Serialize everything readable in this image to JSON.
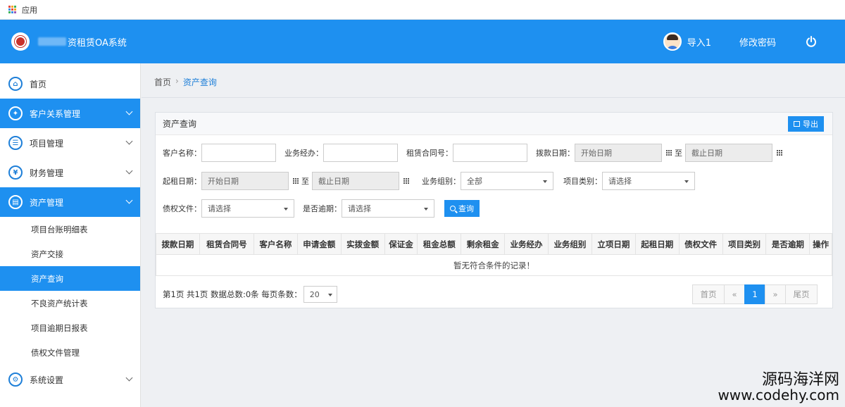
{
  "appbar": {
    "label": "应用",
    "dots": [
      "#e8483b",
      "#f5a623",
      "#3db35a",
      "#3a8ee6",
      "#e8483b",
      "#f5a623",
      "#3db35a",
      "#3a8ee6",
      "#9b59b6"
    ]
  },
  "header": {
    "system_title": "资租赁OA系统",
    "user_name": "导入1",
    "change_password": "修改密码"
  },
  "sidebar": {
    "items": [
      {
        "label": "首页",
        "icon": "⌂"
      },
      {
        "label": "客户关系管理",
        "icon": "✦"
      },
      {
        "label": "项目管理",
        "icon": "☰"
      },
      {
        "label": "财务管理",
        "icon": "¥"
      },
      {
        "label": "资产管理",
        "icon": "▤"
      },
      {
        "label": "系统设置",
        "icon": "⚙"
      }
    ],
    "sub_items": [
      "项目台账明细表",
      "资产交接",
      "资产查询",
      "不良资产统计表",
      "项目逾期日报表",
      "债权文件管理"
    ]
  },
  "breadcrumb": {
    "home": "首页",
    "sep": "›",
    "current": "资产查询"
  },
  "panel": {
    "title": "资产查询",
    "export_label": "导出",
    "filters": {
      "customer_name": "客户名称：",
      "business_agent": "业务经办：",
      "contract_no": "租赁合同号：",
      "disburse_date": "拨款日期：",
      "start_date_ph": "开始日期",
      "end_date_ph": "截止日期",
      "to": "至",
      "rent_start_date": "起租日期：",
      "business_group": "业务组别：",
      "business_group_value": "全部",
      "project_type": "项目类别：",
      "please_select": "请选择",
      "debt_file": "债权文件：",
      "overdue": "是否逾期：",
      "search_label": "查询"
    },
    "table": {
      "headers": [
        "拨款日期",
        "租赁合同号",
        "客户名称",
        "申请金额",
        "实拨金额",
        "保证金",
        "租金总额",
        "剩余租金",
        "业务经办",
        "业务组别",
        "立项日期",
        "起租日期",
        "债权文件",
        "项目类别",
        "是否逾期",
        "操作"
      ],
      "empty_text": "暂无符合条件的记录！"
    },
    "pager": {
      "info": "第1页 共1页 数据总数:0条 每页条数：",
      "page_size": "20",
      "first": "首页",
      "prev": "«",
      "current": "1",
      "next": "»",
      "last": "尾页"
    }
  },
  "watermark": {
    "line1": "源码海洋网",
    "line2": "www.codehy.com"
  },
  "colors": {
    "primary": "#1e90f0",
    "header_bg": "#1e90f0",
    "page_bg": "#eef0f3"
  }
}
